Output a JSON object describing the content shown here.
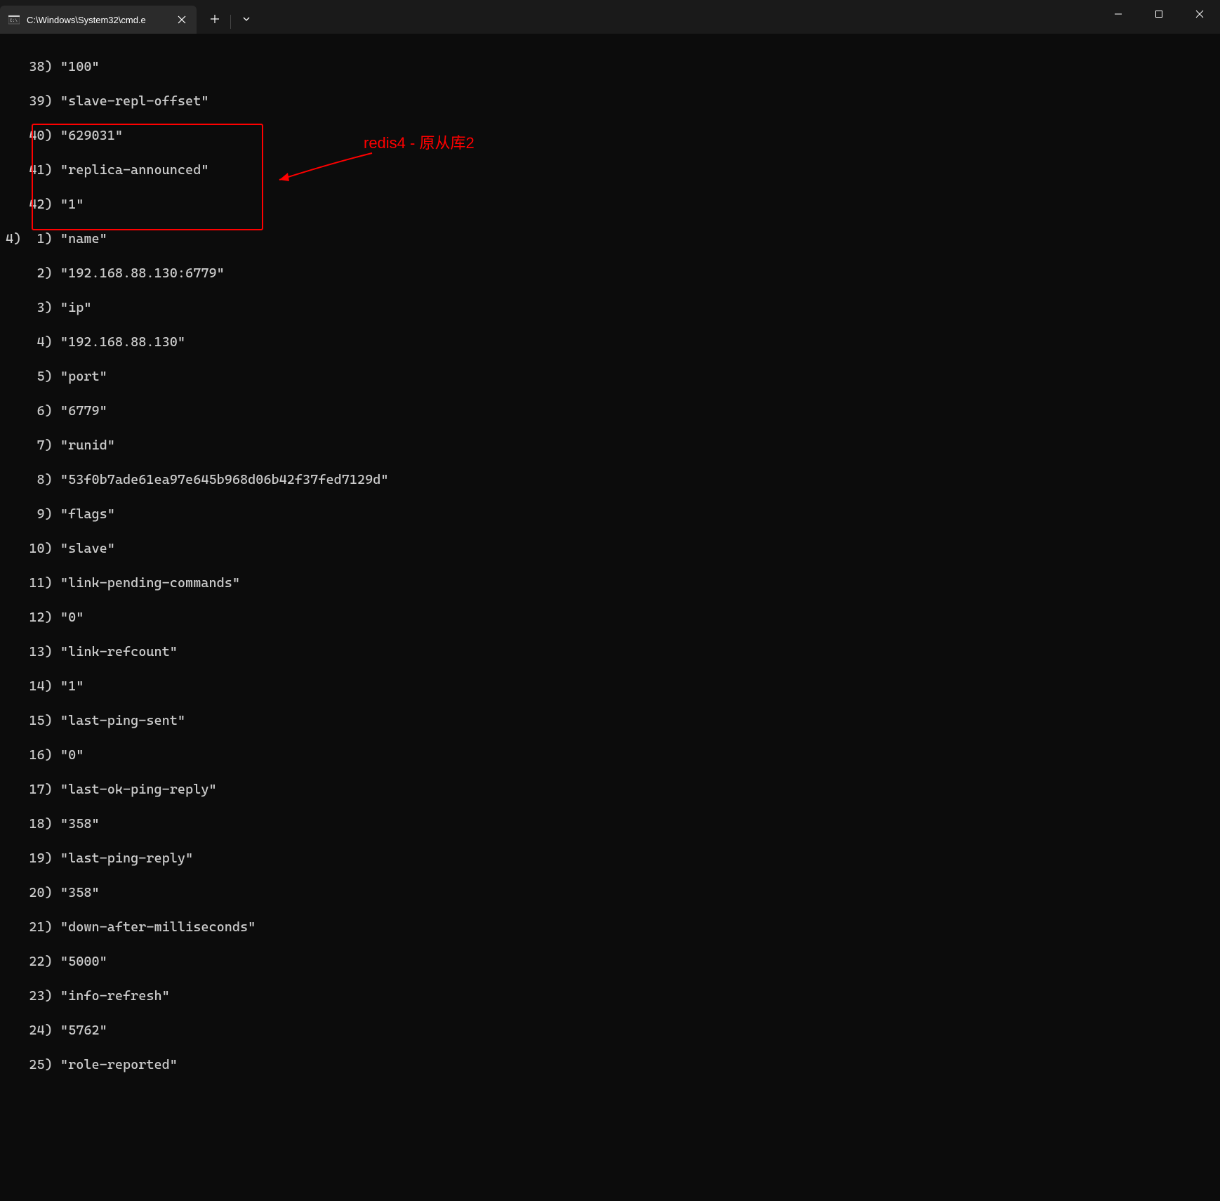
{
  "tab": {
    "title": "C:\\Windows\\System32\\cmd.e"
  },
  "lines": {
    "l0": "   38) \"100\"",
    "l1": "   39) \"slave-repl-offset\"",
    "l2": "   40) \"629031\"",
    "l3": "   41) \"replica-announced\"",
    "l4": "   42) \"1\"",
    "l5": "4)  1) \"name\"",
    "l6": "    2) \"192.168.88.130:6779\"",
    "l7": "    3) \"ip\"",
    "l8": "    4) \"192.168.88.130\"",
    "l9": "    5) \"port\"",
    "l10": "    6) \"6779\"",
    "l11": "    7) \"runid\"",
    "l12": "    8) \"53f0b7ade61ea97e645b968d06b42f37fed7129d\"",
    "l13": "    9) \"flags\"",
    "l14": "   10) \"slave\"",
    "l15": "   11) \"link-pending-commands\"",
    "l16": "   12) \"0\"",
    "l17": "   13) \"link-refcount\"",
    "l18": "   14) \"1\"",
    "l19": "   15) \"last-ping-sent\"",
    "l20": "   16) \"0\"",
    "l21": "   17) \"last-ok-ping-reply\"",
    "l22": "   18) \"358\"",
    "l23": "   19) \"last-ping-reply\"",
    "l24": "   20) \"358\"",
    "l25": "   21) \"down-after-milliseconds\"",
    "l26": "   22) \"5000\"",
    "l27": "   23) \"info-refresh\"",
    "l28": "   24) \"5762\"",
    "l29": "   25) \"role-reported\""
  },
  "annotation": {
    "text": "redis4 - 原从库2"
  }
}
